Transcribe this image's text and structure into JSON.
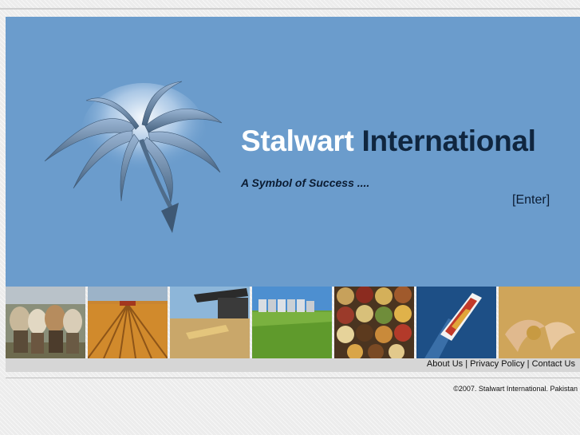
{
  "brand": {
    "title_part1": "Stalwart",
    "title_part2": "International",
    "tagline": "A Symbol of Success ....",
    "enter_label": "[Enter]"
  },
  "colors": {
    "banner": "#6b9ccc",
    "title_white": "#ffffff",
    "title_dark": "#10263f",
    "footer_bar": "#d6d6d6"
  },
  "photos": [
    {
      "name": "cattle"
    },
    {
      "name": "wheat-field"
    },
    {
      "name": "combine-harvester"
    },
    {
      "name": "grain-silos"
    },
    {
      "name": "pulses-and-spices"
    },
    {
      "name": "cargo-ship"
    },
    {
      "name": "grain-in-hands"
    }
  ],
  "footer": {
    "about": "About Us",
    "sep1": " | ",
    "privacy": "Privacy Policy",
    "sep2": " | ",
    "contact": "Contact Us"
  },
  "copyright": "©2007. Stalwart International. Pakistan"
}
